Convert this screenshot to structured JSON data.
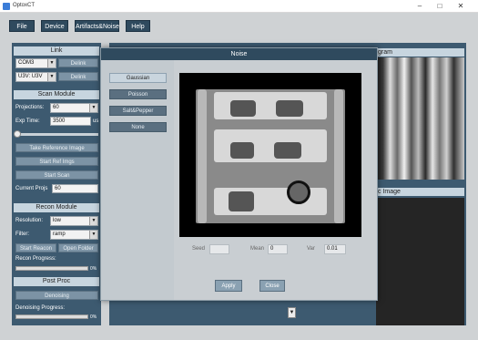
{
  "window": {
    "title": "OptoxCT"
  },
  "menu": {
    "file": "File",
    "device": "Device",
    "artifacts": "Artifacts&Noise",
    "help": "Help"
  },
  "link": {
    "header": "Link",
    "port1": "COM3",
    "delink1": "Delink",
    "port2": "U3V: U3V",
    "delink2": "Delink"
  },
  "scan": {
    "header": "Scan Module",
    "projections_label": "Projections:",
    "projections_value": "60",
    "exp_time_label": "Exp Time:",
    "exp_time_value": "3500",
    "exp_time_unit": "us",
    "take_reference": "Take Reference Image",
    "start_ref": "Start Ref Imgs",
    "start_scan": "Start Scan",
    "current_projs_label": "Current Projs",
    "current_projs_value": "60"
  },
  "recon": {
    "header": "Recon Module",
    "resolution_label": "Resolution:",
    "resolution_value": "low",
    "filter_label": "Filter:",
    "filter_value": "ramp",
    "start_recon": "Start Reacon",
    "open_folder": "Open Folder",
    "progress_label": "Recon Progress:",
    "progress_value": "0%",
    "progress_fraction": 0
  },
  "postproc": {
    "header": "Post Proc",
    "denoising": "Denoising",
    "progress_label": "Denoising Progress:",
    "progress_value": "0%",
    "progress_fraction": 0
  },
  "panels": {
    "sinogram_title": "gram",
    "image_title": "c Image"
  },
  "dialog": {
    "title": "Noise",
    "options": [
      "Gaussian",
      "Poisson",
      "Salt&Pepper",
      "None"
    ],
    "selected": "Gaussian",
    "seed_label": "Seed",
    "seed_value": "",
    "mean_label": "Mean",
    "mean_value": "0",
    "var_label": "Var",
    "var_value": "0.01",
    "apply": "Apply",
    "close": "Close"
  },
  "icons": {
    "scroll_down": "down-arrow-icon",
    "minimize": "minimize-icon",
    "maximize": "maximize-icon",
    "close": "close-icon"
  }
}
